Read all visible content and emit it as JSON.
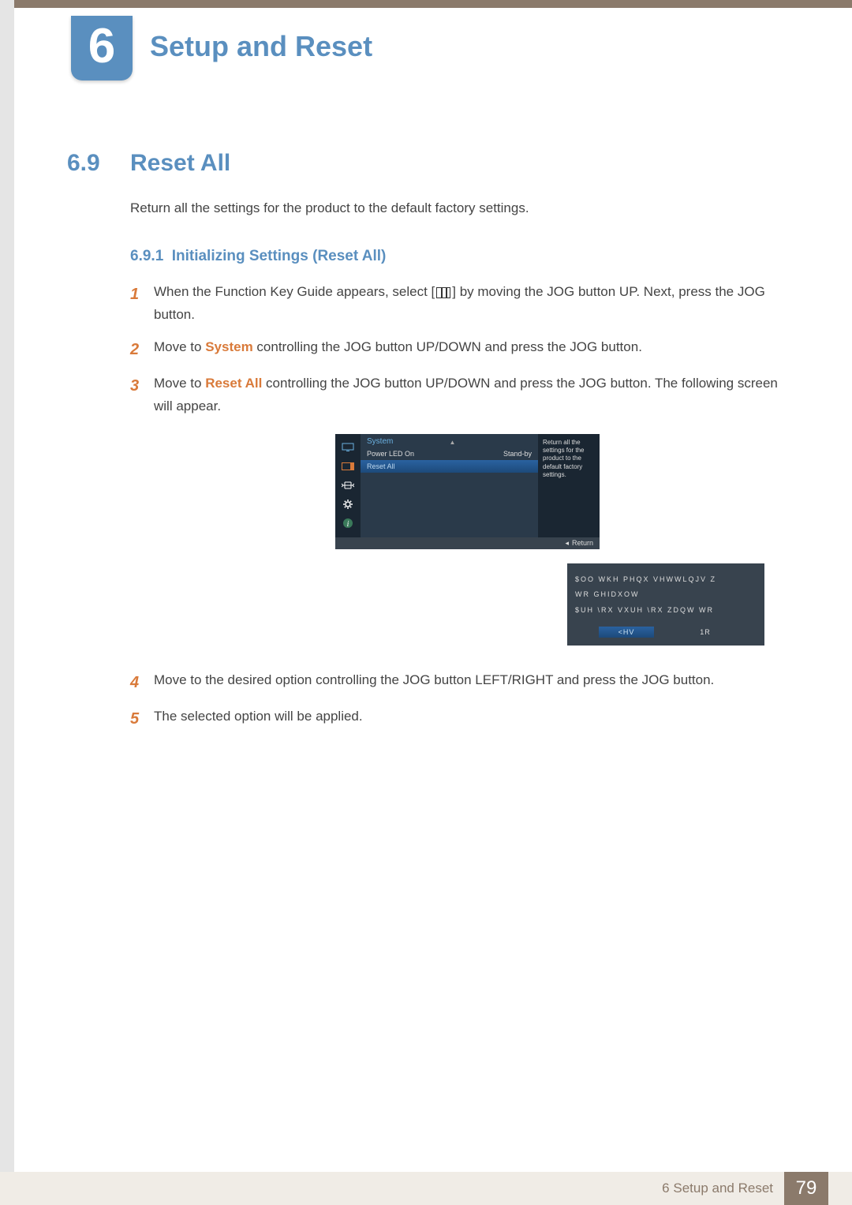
{
  "chapter": {
    "num": "6",
    "title": "Setup and Reset"
  },
  "section": {
    "num": "6.9",
    "title": "Reset All"
  },
  "intro": "Return all the settings for the product to the default factory settings.",
  "subsection": {
    "num": "6.9.1",
    "title": "Initializing Settings (Reset All)"
  },
  "steps": {
    "s1": {
      "n": "1",
      "pre": "When the Function Key Guide appears, select [",
      "post": "] by moving the JOG button UP. Next, press the JOG button."
    },
    "s2": {
      "n": "2",
      "pre": "Move to ",
      "em": "System",
      "post": " controlling the JOG button UP/DOWN and press the JOG button."
    },
    "s3": {
      "n": "3",
      "pre": "Move to ",
      "em": "Reset All",
      "post": " controlling the JOG button UP/DOWN and press the JOG button. The following screen will appear."
    },
    "s4": {
      "n": "4",
      "text": "Move to the desired option controlling the JOG button LEFT/RIGHT and press the JOG button."
    },
    "s5": {
      "n": "5",
      "text": "The selected option will be applied."
    }
  },
  "osd": {
    "header": "System",
    "row1_left": "Power LED On",
    "row1_right": "Stand-by",
    "row2": "Reset All",
    "desc": "Return all the settings for the product to the default factory settings.",
    "return": "Return"
  },
  "dialog": {
    "line1": "$OO WKH PHQX VHWWLQJV Z",
    "line2": "WR GHIDXOW",
    "line3": "$UH \\RX VXUH \\RX ZDQW WR",
    "yes": "<HV",
    "no": "1R"
  },
  "footer": {
    "label": "6 Setup and Reset",
    "page": "79"
  }
}
